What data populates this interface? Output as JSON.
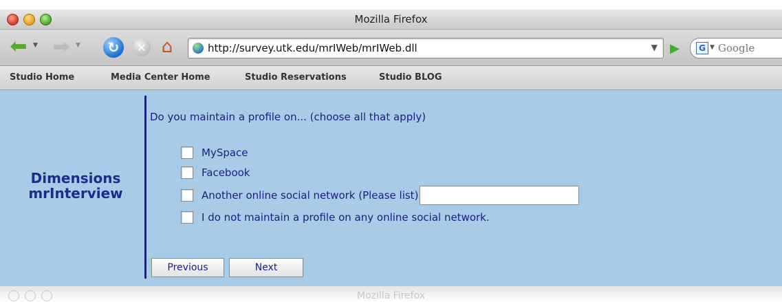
{
  "window": {
    "title": "Mozilla Firefox"
  },
  "toolbar": {
    "url": "http://survey.utk.edu/mrIWeb/mrIWeb.dll",
    "search_placeholder": "Google"
  },
  "bookmarks": [
    {
      "label": "Studio Home"
    },
    {
      "label": "Media Center Home"
    },
    {
      "label": "Studio Reservations"
    },
    {
      "label": "Studio BLOG"
    }
  ],
  "sidebar": {
    "brand_line1": "Dimensions",
    "brand_line2": "mrInterview"
  },
  "survey": {
    "question": "Do you maintain a profile on... (choose all that apply)",
    "options": [
      {
        "label": "MySpace",
        "checked": false
      },
      {
        "label": "Facebook",
        "checked": false
      },
      {
        "label": "Another online social network (Please list)",
        "checked": false
      },
      {
        "label": "I do not maintain a profile on any online social network.",
        "checked": false
      }
    ],
    "other_value": "",
    "previous_label": "Previous",
    "next_label": "Next"
  },
  "reflection": {
    "title": "Mozilla Firefox"
  },
  "colors": {
    "content_bg": "#a8cbe8",
    "text": "#1a2080",
    "divider": "#1a2380"
  }
}
